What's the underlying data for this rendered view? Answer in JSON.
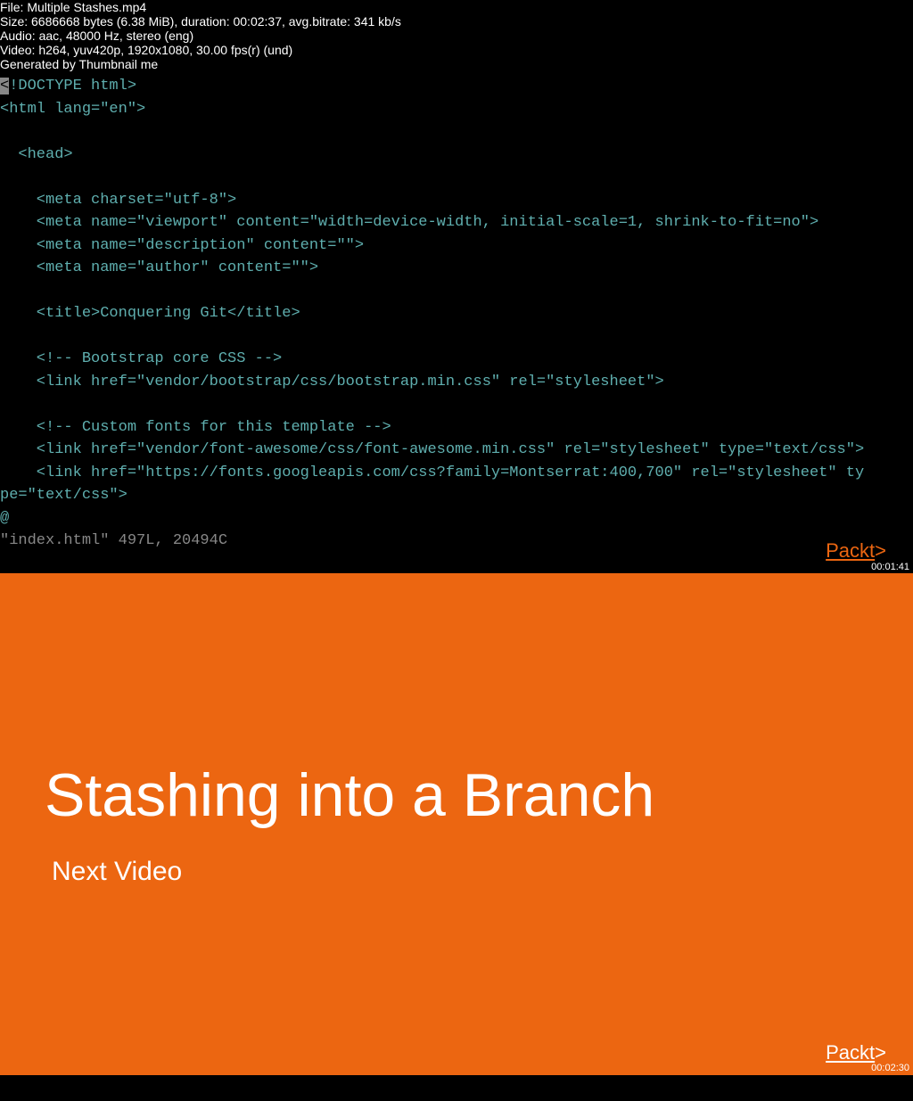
{
  "metadata": {
    "file": "File: Multiple Stashes.mp4",
    "size": "Size: 6686668 bytes (6.38 MiB), duration: 00:02:37, avg.bitrate: 341 kb/s",
    "audio": "Audio: aac, 48000 Hz, stereo (eng)",
    "video": "Video: h264, yuv420p, 1920x1080, 30.00 fps(r) (und)",
    "generated": "Generated by Thumbnail me"
  },
  "frame1": {
    "code": {
      "l1_hl": "<",
      "l1_rest": "!DOCTYPE html>",
      "l2": "<html lang=\"en\">",
      "l3": "",
      "l4": "  <head>",
      "l5": "",
      "l6": "    <meta charset=\"utf-8\">",
      "l7": "    <meta name=\"viewport\" content=\"width=device-width, initial-scale=1, shrink-to-fit=no\">",
      "l8": "    <meta name=\"description\" content=\"\">",
      "l9": "    <meta name=\"author\" content=\"\">",
      "l10": "",
      "l11": "    <title>Conquering Git</title>",
      "l12": "",
      "l13": "    <!-- Bootstrap core CSS -->",
      "l14": "    <link href=\"vendor/bootstrap/css/bootstrap.min.css\" rel=\"stylesheet\">",
      "l15": "",
      "l16": "    <!-- Custom fonts for this template -->",
      "l17": "    <link href=\"vendor/font-awesome/css/font-awesome.min.css\" rel=\"stylesheet\" type=\"text/css\">",
      "l18a": "    <link href=\"https://fonts.googleapis.com/css?family=Montserrat:400,700\" rel=\"stylesheet\" ty",
      "l18b": "pe=\"text/css\">",
      "l19_at": "@",
      "l20": "\"index.html\" 497L, 20494C"
    },
    "packt": "Packt",
    "packt_bracket": ">",
    "timestamp": "00:01:41"
  },
  "frame2": {
    "title": "Stashing into a Branch",
    "subtitle": "Next Video",
    "packt": "Packt",
    "packt_bracket": ">",
    "timestamp": "00:02:30"
  }
}
